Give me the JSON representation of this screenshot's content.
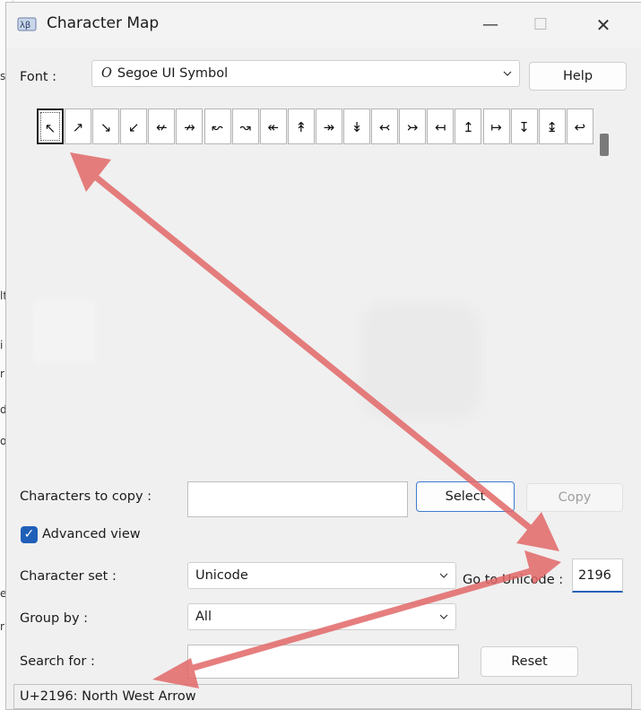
{
  "window": {
    "title": "Character Map"
  },
  "titlebar": {
    "minimize": "—",
    "maximize": "☐",
    "close": "✕"
  },
  "font_row": {
    "label": "Font :",
    "font_icon": "𝑂",
    "value": "Segoe UI Symbol",
    "help": "Help"
  },
  "grid": {
    "chars": [
      "↖",
      "↗",
      "↘",
      "↙",
      "↚",
      "↛",
      "↜",
      "↝",
      "↞",
      "↟",
      "↠",
      "↡",
      "↢",
      "↣",
      "↤",
      "↥",
      "↦",
      "↧",
      "↨",
      "↩"
    ]
  },
  "copy_row": {
    "label": "Characters to copy :",
    "value": "",
    "select": "Select",
    "copy": "Copy"
  },
  "advanced": {
    "checkmark": "✓",
    "label": "Advanced view"
  },
  "charset": {
    "label": "Character set :",
    "value": "Unicode"
  },
  "goto": {
    "label": "Go to Unicode :",
    "value": "2196"
  },
  "groupby": {
    "label": "Group by :",
    "value": "All"
  },
  "search": {
    "label": "Search for :",
    "value": "",
    "reset": "Reset"
  },
  "status": {
    "text": "U+2196: North West Arrow"
  },
  "background_fragments": [
    "s",
    "lt",
    "i",
    "r",
    "d",
    "o",
    "e",
    "r"
  ],
  "colors": {
    "arrow": "#e26868",
    "accent": "#1f5fb8"
  }
}
